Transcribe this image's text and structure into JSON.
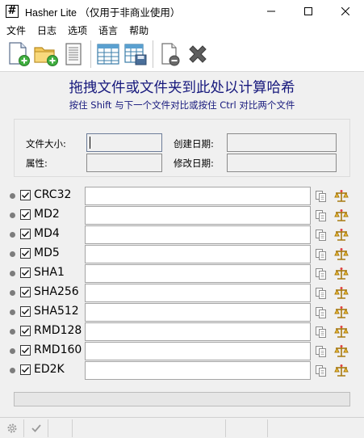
{
  "window": {
    "app_icon_glyph": "#",
    "title": "Hasher Lite （仅用于非商业使用）"
  },
  "menu": [
    "文件",
    "日志",
    "选项",
    "语言",
    "帮助"
  ],
  "toolbar": {
    "icons": [
      "new-file-icon",
      "open-folder-icon",
      "document-list-icon",
      "table-grid-icon",
      "table-save-icon",
      "page-remove-icon",
      "close-x-icon"
    ]
  },
  "main": {
    "headline": "拖拽文件或文件夹到此处以计算哈希",
    "subline": "按住 Shift 与下一个文件对比或按住 Ctrl 对比两个文件"
  },
  "info": {
    "file_size_label": "文件大小:",
    "created_label": "创建日期:",
    "attributes_label": "属性:",
    "modified_label": "修改日期:",
    "file_size_value": "",
    "created_value": "",
    "attributes_value": "",
    "modified_value": ""
  },
  "hashes": [
    {
      "name": "CRC32",
      "checked": true,
      "value": ""
    },
    {
      "name": "MD2",
      "checked": true,
      "value": ""
    },
    {
      "name": "MD4",
      "checked": true,
      "value": ""
    },
    {
      "name": "MD5",
      "checked": true,
      "value": ""
    },
    {
      "name": "SHA1",
      "checked": true,
      "value": ""
    },
    {
      "name": "SHA256",
      "checked": true,
      "value": ""
    },
    {
      "name": "SHA512",
      "checked": true,
      "value": ""
    },
    {
      "name": "RMD128",
      "checked": true,
      "value": ""
    },
    {
      "name": "RMD160",
      "checked": true,
      "value": ""
    },
    {
      "name": "ED2K",
      "checked": true,
      "value": ""
    }
  ],
  "colors": {
    "headline": "#17197d",
    "panel_bg": "#f0f0f0",
    "dot": "#7d7d7d"
  }
}
